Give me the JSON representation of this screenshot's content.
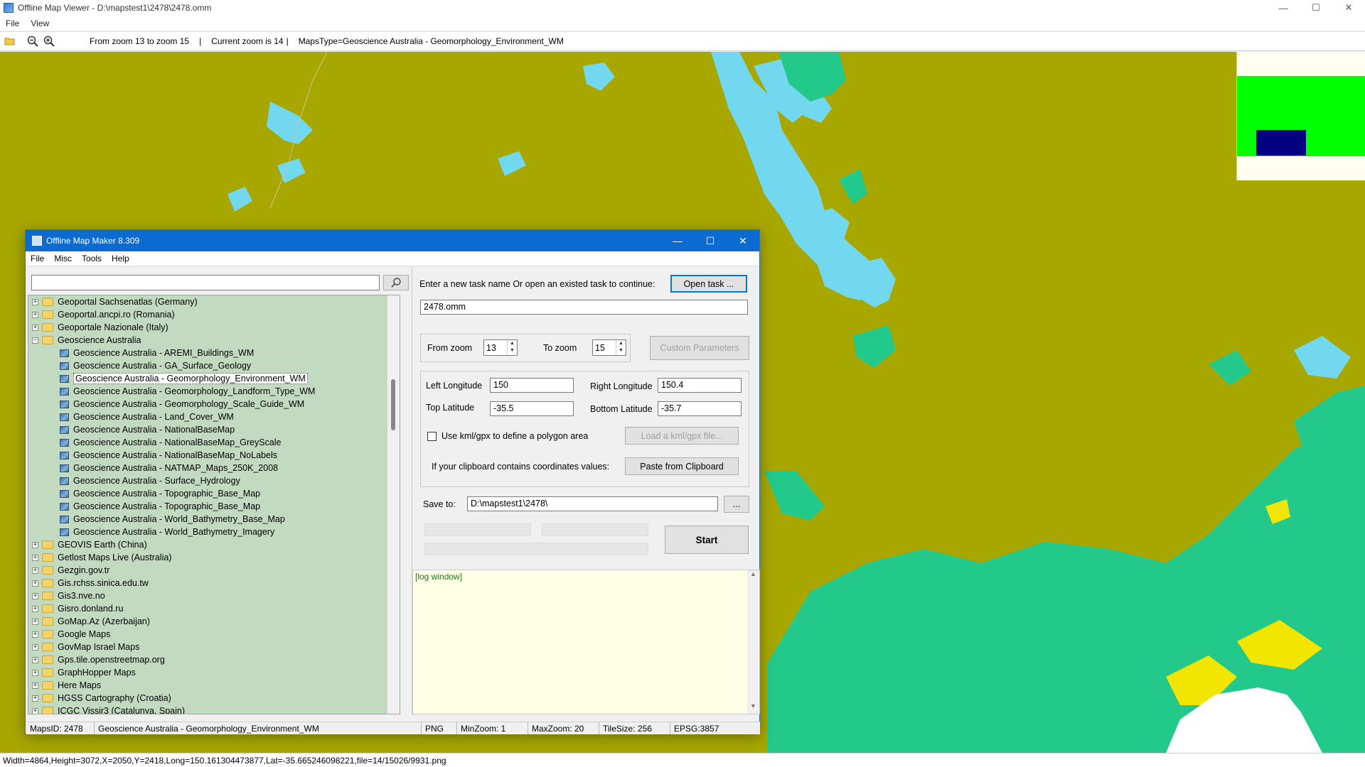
{
  "window": {
    "title": "Offline Map Viewer - D:\\mapstest1\\2478\\2478.omm",
    "controls": {
      "minimize": "—",
      "maximize": "☐",
      "close": "✕"
    }
  },
  "menu": {
    "file": "File",
    "view": "View"
  },
  "toolbar": {
    "zoom_range": "From zoom 13 to zoom 15",
    "sep1": "|",
    "current_zoom": "Current zoom is 14",
    "sep2": "|",
    "maps_type": "MapsType=Geoscience Australia - Geomorphology_Environment_WM",
    "icons": [
      "open-folder-icon",
      "zoom-out-icon",
      "zoom-in-icon"
    ]
  },
  "status_bar": {
    "text": "Width=4864,Height=3072,X=2050,Y=2418,Long=150.161304473877,Lat=-35.665246098221,file=14/15026/9931.png"
  },
  "dialog": {
    "title": "Offline Map Maker 8.309",
    "controls": {
      "minimize": "—",
      "maximize": "☐",
      "close": "✕"
    },
    "menu": {
      "file": "File",
      "misc": "Misc",
      "tools": "Tools",
      "help": "Help"
    },
    "search": {
      "value": "",
      "icon": "search-icon"
    },
    "tree": [
      {
        "label": "Geoportal Sachsenatlas (Germany)",
        "type": "folder",
        "expanded": false
      },
      {
        "label": "Geoportal.ancpi.ro (Romania)",
        "type": "folder",
        "expanded": false
      },
      {
        "label": "Geoportale Nazionale (Italy)",
        "type": "folder",
        "expanded": false
      },
      {
        "label": "Geoscience Australia",
        "type": "folder",
        "expanded": true
      },
      {
        "label": "Geoscience Australia - AREMI_Buildings_WM",
        "type": "leaf"
      },
      {
        "label": "Geoscience Australia - GA_Surface_Geology",
        "type": "leaf"
      },
      {
        "label": "Geoscience Australia - Geomorphology_Environment_WM",
        "type": "leaf",
        "selected": true
      },
      {
        "label": "Geoscience Australia - Geomorphology_Landform_Type_WM",
        "type": "leaf"
      },
      {
        "label": "Geoscience Australia - Geomorphology_Scale_Guide_WM",
        "type": "leaf"
      },
      {
        "label": "Geoscience Australia - Land_Cover_WM",
        "type": "leaf"
      },
      {
        "label": "Geoscience Australia - NationalBaseMap",
        "type": "leaf"
      },
      {
        "label": "Geoscience Australia - NationalBaseMap_GreyScale",
        "type": "leaf"
      },
      {
        "label": "Geoscience Australia - NationalBaseMap_NoLabels",
        "type": "leaf"
      },
      {
        "label": "Geoscience Australia - NATMAP_Maps_250K_2008",
        "type": "leaf"
      },
      {
        "label": "Geoscience Australia - Surface_Hydrology",
        "type": "leaf"
      },
      {
        "label": "Geoscience Australia - Topographic_Base_Map",
        "type": "leaf"
      },
      {
        "label": "Geoscience Australia - Topographic_Base_Map",
        "type": "leaf"
      },
      {
        "label": "Geoscience Australia - World_Bathymetry_Base_Map",
        "type": "leaf"
      },
      {
        "label": "Geoscience Australia - World_Bathymetry_Imagery",
        "type": "leaf"
      },
      {
        "label": "GEOVIS Earth (China)",
        "type": "folder",
        "expanded": false
      },
      {
        "label": "Getlost Maps Live (Australia)",
        "type": "folder",
        "expanded": false
      },
      {
        "label": "Gezgin.gov.tr",
        "type": "folder",
        "expanded": false
      },
      {
        "label": "Gis.rchss.sinica.edu.tw",
        "type": "folder",
        "expanded": false
      },
      {
        "label": "Gis3.nve.no",
        "type": "folder",
        "expanded": false
      },
      {
        "label": "Gisro.donland.ru",
        "type": "folder",
        "expanded": false
      },
      {
        "label": "GoMap.Az (Azerbaijan)",
        "type": "folder",
        "expanded": false
      },
      {
        "label": "Google Maps",
        "type": "folder",
        "expanded": false
      },
      {
        "label": "GovMap Israel Maps",
        "type": "folder",
        "expanded": false
      },
      {
        "label": "Gps.tile.openstreetmap.org",
        "type": "folder",
        "expanded": false
      },
      {
        "label": "GraphHopper Maps",
        "type": "folder",
        "expanded": false
      },
      {
        "label": "Here Maps",
        "type": "folder",
        "expanded": false
      },
      {
        "label": "HGSS Cartography (Croatia)",
        "type": "folder",
        "expanded": false
      },
      {
        "label": "ICGC Vissir3 (Catalunya, Spain)",
        "type": "folder",
        "expanded": false
      }
    ],
    "task": {
      "prompt": "Enter a new task name Or open an existed task to continue:",
      "open_button": "Open task ...",
      "name_value": "2478.omm"
    },
    "zoom": {
      "from_label": "From zoom",
      "from_value": "13",
      "to_label": "To zoom",
      "to_value": "15",
      "custom_button": "Custom Parameters"
    },
    "coords": {
      "left_lon_label": "Left Longitude",
      "left_lon_value": "150",
      "right_lon_label": "Right Longitude",
      "right_lon_value": "150.4",
      "top_lat_label": "Top Latitude",
      "top_lat_value": "-35.5",
      "bottom_lat_label": "Bottom Latitude",
      "bottom_lat_value": "-35.7",
      "kml_label": "Use kml/gpx to define a polygon area",
      "kml_button": "Load a kml/gpx file...",
      "clipboard_label": "If your clipboard contains coordinates values:",
      "clipboard_button": "Paste from Clipboard"
    },
    "save": {
      "label": "Save to:",
      "value": "D:\\mapstest1\\2478\\",
      "browse_button": "..."
    },
    "start_button": "Start",
    "log": {
      "text": "[log window]"
    },
    "status": {
      "maps_id": "MapsID: 2478",
      "maps_name": "Geoscience Australia - Geomorphology_Environment_WM",
      "format": "PNG",
      "min_zoom": "MinZoom: 1",
      "max_zoom": "MaxZoom: 20",
      "tile_size": "TileSize: 256",
      "epsg": "EPSG:3857"
    }
  },
  "colors": {
    "map_land": "#a7a700",
    "map_water": "#72d8f0",
    "map_forest": "#22c98a",
    "tree_background": "#c2dbc0",
    "dialog_title": "#0b6bd1",
    "log_background": "#ffffe6"
  }
}
